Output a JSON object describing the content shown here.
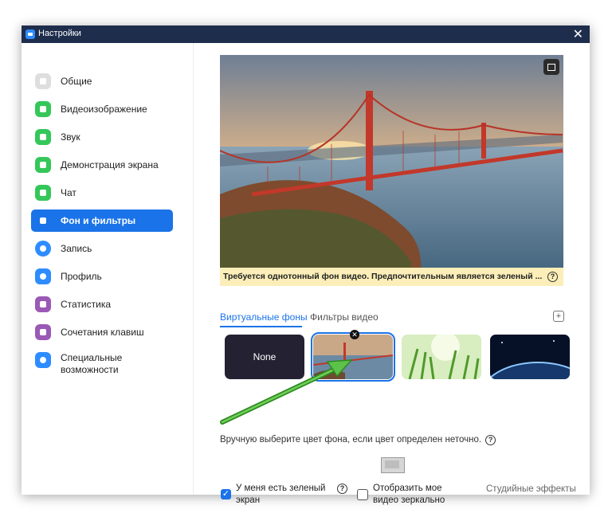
{
  "window": {
    "title": "Настройки",
    "close_glyph": "✕"
  },
  "sidebar": {
    "items": [
      {
        "label": "Общие",
        "icon": "gear-icon",
        "color": "#d9d9d9"
      },
      {
        "label": "Видеоизображение",
        "icon": "video-camera-icon",
        "color": "#34c759"
      },
      {
        "label": "Звук",
        "icon": "headphones-icon",
        "color": "#34c759"
      },
      {
        "label": "Демонстрация экрана",
        "icon": "share-screen-icon",
        "color": "#34c759"
      },
      {
        "label": "Чат",
        "icon": "chat-bubble-icon",
        "color": "#34c759"
      },
      {
        "label": "Фон и фильтры",
        "icon": "background-icon",
        "color": "#1a73e8"
      },
      {
        "label": "Запись",
        "icon": "record-icon",
        "color": "#2d8cff"
      },
      {
        "label": "Профиль",
        "icon": "profile-icon",
        "color": "#2d8cff"
      },
      {
        "label": "Статистика",
        "icon": "statistics-icon",
        "color": "#9b59b6"
      },
      {
        "label": "Сочетания клавиш",
        "icon": "keyboard-icon",
        "color": "#9b59b6"
      },
      {
        "label": "Специальные возможности",
        "icon": "accessibility-icon",
        "color": "#2d8cff"
      }
    ],
    "active_index": 5
  },
  "preview": {
    "warning": "Требуется однотонный фон видео. Предпочтительным является зеленый ...",
    "help_glyph": "?"
  },
  "tabs": [
    {
      "label": "Виртуальные фоны",
      "active": true
    },
    {
      "label": "Фильтры видео",
      "active": false
    }
  ],
  "add_glyph": "+",
  "backgrounds": [
    {
      "label": "None",
      "selected": false
    },
    {
      "label": "",
      "selected": true
    },
    {
      "label": "",
      "selected": false
    },
    {
      "label": "",
      "selected": false
    }
  ],
  "remove_glyph": "✕",
  "manual_color_text": "Вручную выберите цвет фона, если цвет определен неточно.",
  "options": {
    "green_screen": {
      "label": "У меня есть зеленый экран",
      "checked": true
    },
    "mirror": {
      "label": "Отобразить мое видео зеркально",
      "checked": false
    },
    "studio_effects": "Студийные эффекты"
  },
  "colors": {
    "accent": "#1a73e8",
    "titlebar": "#1f2d4d",
    "warning_bg": "#fbeeb8",
    "arrow": "#3cb043"
  }
}
